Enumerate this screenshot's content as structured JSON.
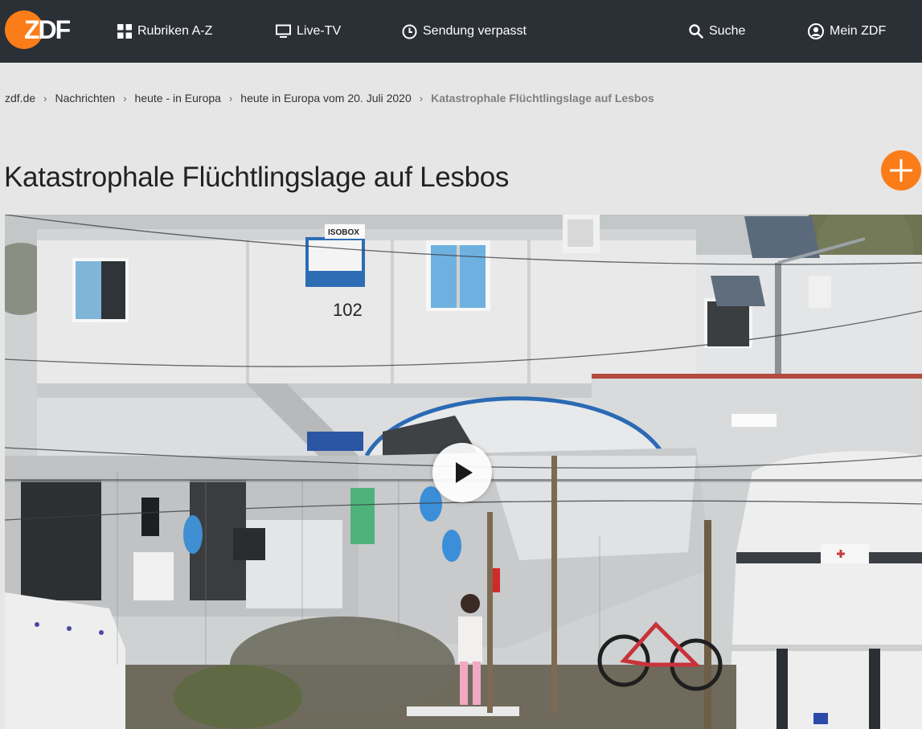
{
  "header": {
    "logo_label": "ZDF",
    "nav": [
      {
        "label": "Rubriken A-Z",
        "icon": "grid-icon"
      },
      {
        "label": "Live-TV",
        "icon": "tv-icon"
      },
      {
        "label": "Sendung verpasst",
        "icon": "clock-icon"
      },
      {
        "label": "Suche",
        "icon": "search-icon"
      },
      {
        "label": "Mein ZDF",
        "icon": "user-icon"
      }
    ]
  },
  "breadcrumb": [
    "zdf.de",
    "Nachrichten",
    "heute - in Europa",
    "heute in Europa vom 20. Juli 2020",
    "Katastrophale Flüchtlingslage auf Lesbos"
  ],
  "page": {
    "title": "Katastrophale Flüchtlingslage auf Lesbos"
  },
  "video": {
    "container_sign_brand": "ISOBOX",
    "container_number": "102",
    "play_icon": "play-icon",
    "add_icon": "plus-icon"
  },
  "colors": {
    "brand": "#fa7d19",
    "header_bg": "#2b2f36",
    "page_bg": "#e6e6e6"
  }
}
